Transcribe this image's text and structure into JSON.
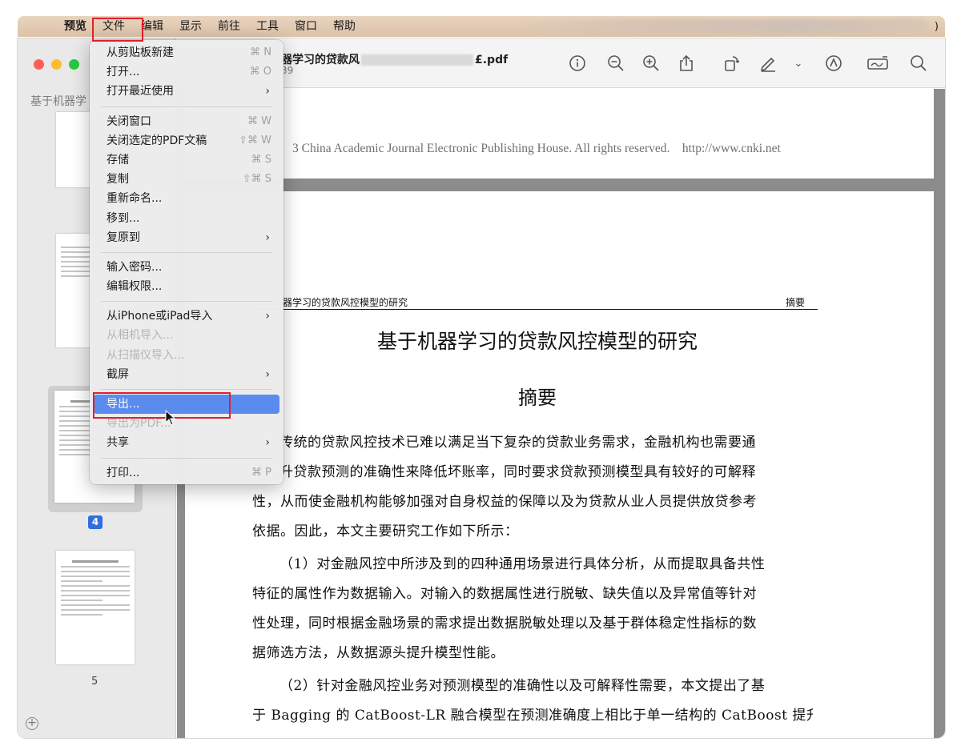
{
  "menubar": {
    "app": "预览",
    "items": [
      "文件",
      "编辑",
      "显示",
      "前往",
      "工具",
      "窗口",
      "帮助"
    ],
    "right_fragment": ")"
  },
  "sidebar": {
    "title": "基于机器学",
    "selected_page": "4",
    "page_label_5": "5"
  },
  "toolbar": {
    "title_prefix": "器学习的贷款风",
    "title_suffix": "£.pdf",
    "subtitle": "39",
    "icons": [
      "info-icon",
      "zoom-out-icon",
      "zoom-in-icon",
      "share-icon",
      "rotate-icon",
      "markup-pen-icon",
      "chevron-down-icon",
      "annotate-icon",
      "signature-icon",
      "search-icon"
    ]
  },
  "document": {
    "copyright": "3 China Academic Journal Electronic Publishing House. All rights reserved.    http://www.cnki.net",
    "header_left": "器学习的贷款风控模型的研究",
    "header_right": "摘要",
    "title": "基于机器学习的贷款风控模型的研究",
    "abstract_heading": "摘要",
    "para1": [
      "传统的贷款风控技术已难以满足当下复杂的贷款业务需求，金融机构也需要通",
      "升贷款预测的准确性来降低坏账率，同时要求贷款预测模型具有较好的可解释",
      "性，从而使金融机构能够加强对自身权益的保障以及为贷款从业人员提供放贷参考",
      "依据。因此，本文主要研究工作如下所示："
    ],
    "para2": [
      "（1）对金融风控中所涉及到的四种通用场景进行具体分析，从而提取具备共性",
      "特征的属性作为数据输入。对输入的数据属性进行脱敏、缺失值以及异常值等针对",
      "性处理，同时根据金融场景的需求提出数据脱敏处理以及基于群体稳定性指标的数",
      "据筛选方法，从数据源头提升模型性能。"
    ],
    "para3": [
      "（2）针对金融风控业务对预测模型的准确性以及可解释性需要，本文提出了基",
      "于 Bagging 的 CatBoost-LR 融合模型在预测准确度上相比于单一结构的 CatBoost 提升"
    ]
  },
  "file_menu": {
    "items": [
      {
        "label": "从剪贴板新建",
        "shortcut": "⌘ N"
      },
      {
        "label": "打开...",
        "shortcut": "⌘ O"
      },
      {
        "label": "打开最近使用",
        "arrow": "›"
      },
      {
        "label": "关闭窗口",
        "shortcut": "⌘ W"
      },
      {
        "label": "关闭选定的PDF文稿",
        "shortcut": "⇧⌘ W"
      },
      {
        "label": "存储",
        "shortcut": "⌘ S"
      },
      {
        "label": "复制",
        "shortcut": "⇧⌘ S"
      },
      {
        "label": "重新命名..."
      },
      {
        "label": "移到..."
      },
      {
        "label": "复原到",
        "arrow": "›"
      },
      {
        "label": "输入密码..."
      },
      {
        "label": "编辑权限..."
      },
      {
        "label": "从iPhone或iPad导入",
        "arrow": "›"
      },
      {
        "label": "从相机导入..."
      },
      {
        "label": "从扫描仪导入..."
      },
      {
        "label": "截屏",
        "arrow": "›"
      },
      {
        "label": "导出..."
      },
      {
        "label": "导出为PDF..."
      },
      {
        "label": "共享",
        "arrow": "›"
      },
      {
        "label": "打印...",
        "shortcut": "⌘ P"
      }
    ]
  }
}
